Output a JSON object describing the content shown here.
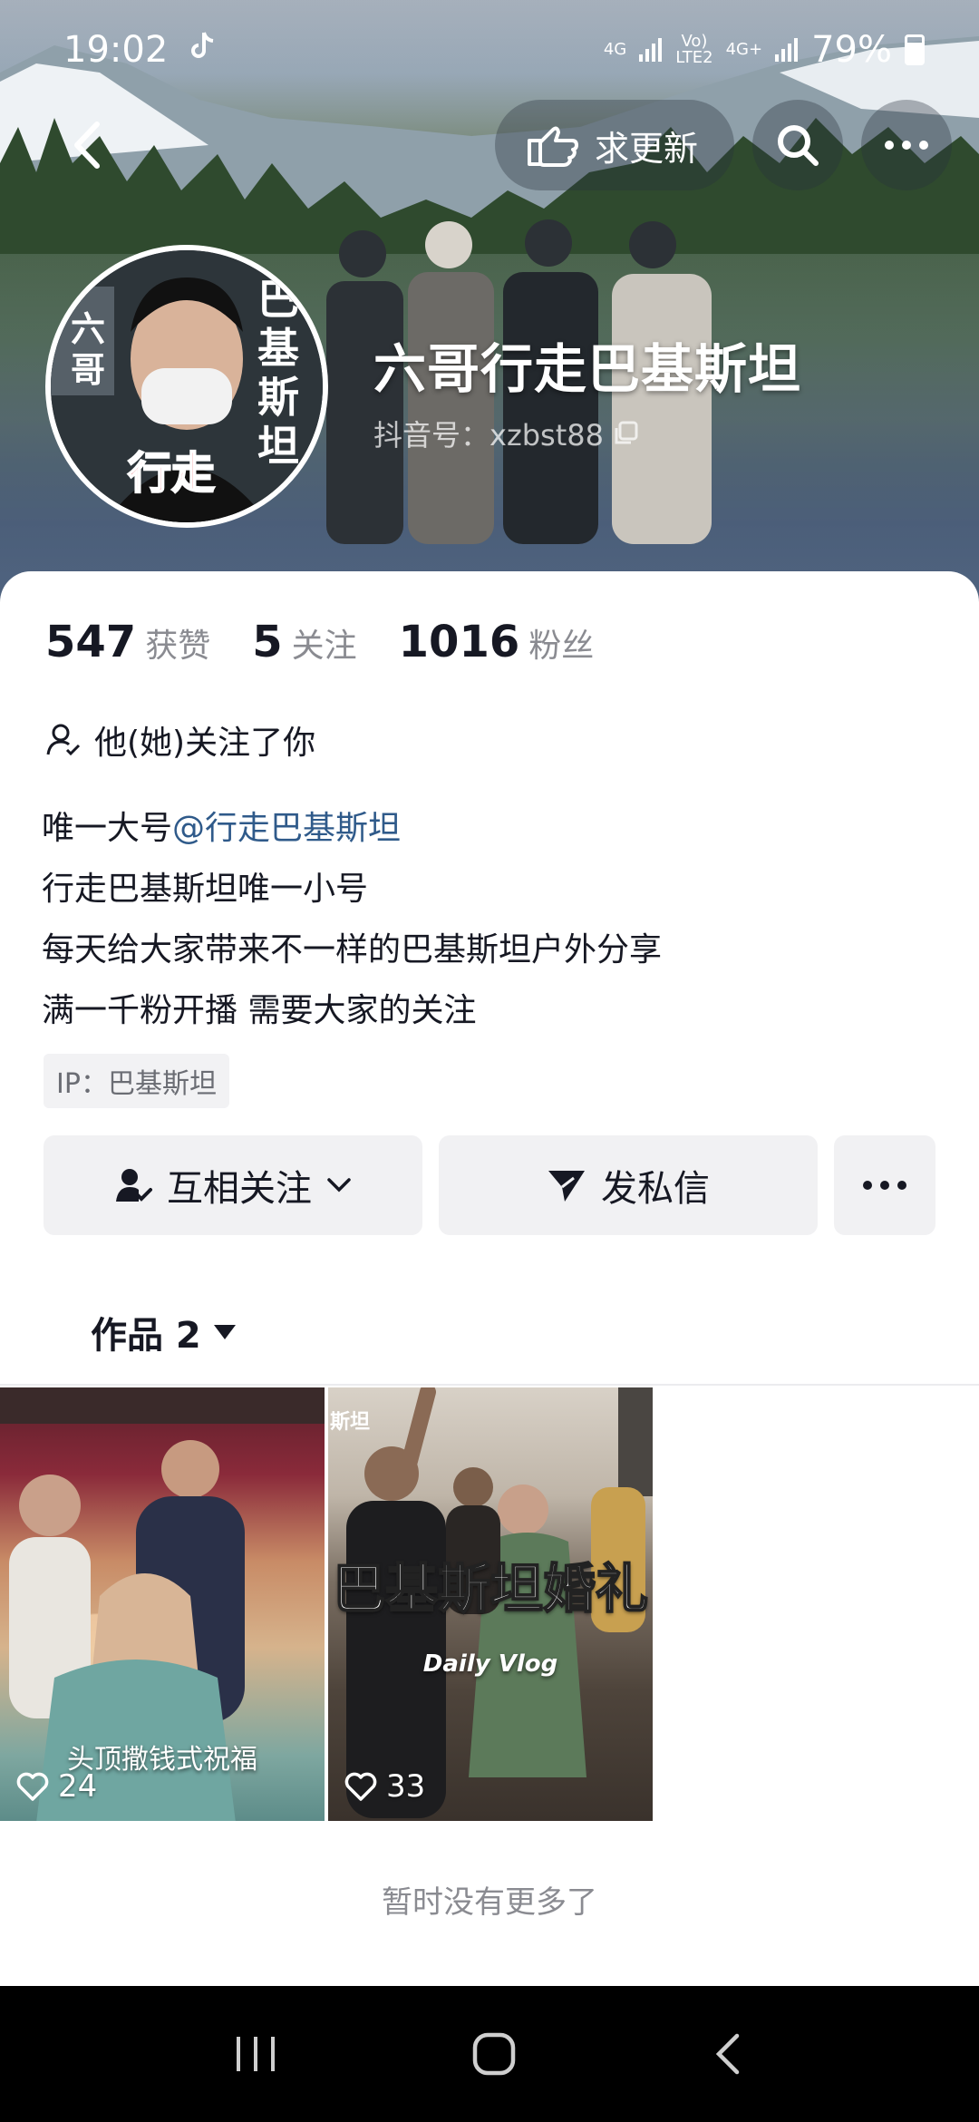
{
  "status_bar": {
    "time": "19:02",
    "net1": "4G",
    "net2_top": "Vo)",
    "net2_bottom": "LTE2",
    "net3": "4G+",
    "battery_percent": "79%",
    "battery_level": 0.79
  },
  "header": {
    "update_label": "求更新",
    "icons": [
      "back-icon",
      "hand-pointing-icon",
      "search-icon",
      "more-icon"
    ]
  },
  "profile": {
    "name": "六哥行走巴基斯坦",
    "douyin_id": "抖音号：xzbst88",
    "avatar_text_right": "巴基斯坦",
    "avatar_text_left": "六哥",
    "avatar_text_bottom": "行走"
  },
  "stats": [
    {
      "value": "547",
      "label": "获赞"
    },
    {
      "value": "5",
      "label": "关注"
    },
    {
      "value": "1016",
      "label": "粉丝"
    }
  ],
  "follow_note": "他(她)关注了你",
  "bio": {
    "line1_prefix": "唯一大号",
    "line1_mention": "@行走巴基斯坦",
    "line2": "行走巴基斯坦唯一小号",
    "line3": "每天给大家带来不一样的巴基斯坦户外分享",
    "line4": "满一千粉开播 需要大家的关注"
  },
  "ip_tag": "IP：巴基斯坦",
  "actions": {
    "follow_label": "互相关注",
    "dm_label": "发私信"
  },
  "works_tab": {
    "label": "作品 2"
  },
  "videos": [
    {
      "caption": "头顶撒钱式祝福",
      "likes": "24"
    },
    {
      "caption_big": "巴基斯坦婚礼",
      "caption_small": "Daily Vlog",
      "corner_text": "斯坦",
      "likes": "33"
    }
  ],
  "footer_note": "暂时没有更多了",
  "colors": {
    "mention": "#2f5a8a",
    "card_bg": "#ffffff",
    "button_bg": "#f1f1f3",
    "muted_text": "#8a8b91"
  }
}
